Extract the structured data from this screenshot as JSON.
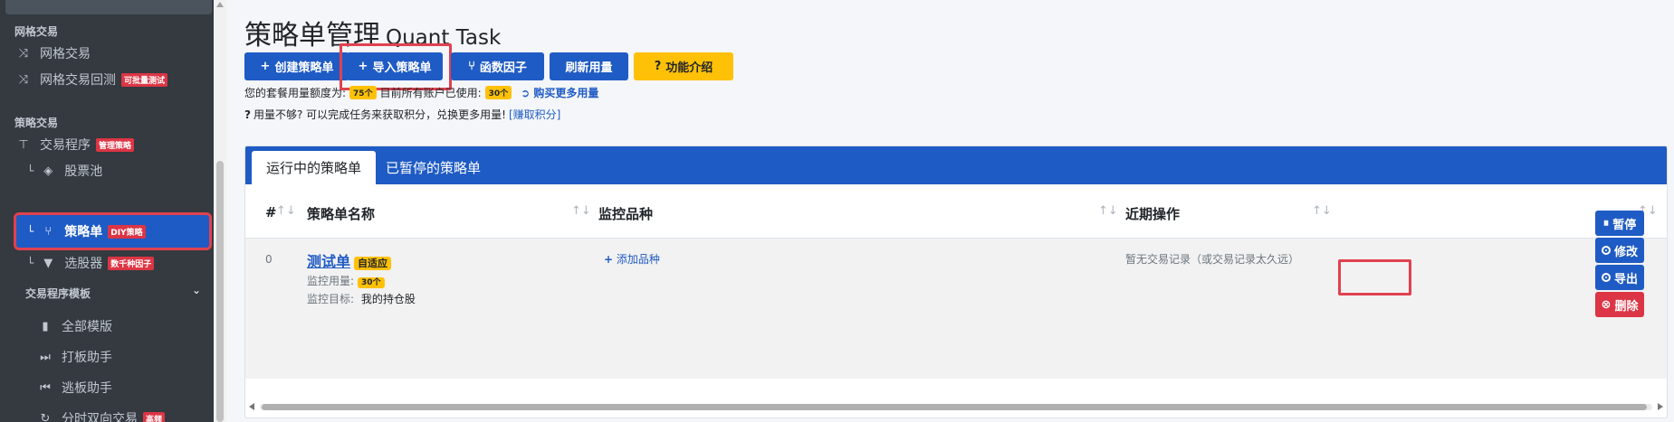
{
  "sidebar": {
    "sections": [
      {
        "header": "网格交易",
        "items": [
          {
            "label": "网格交易",
            "icon": "shuffle-icon"
          },
          {
            "label": "网格交易回测",
            "icon": "shuffle-icon",
            "badge": "可批量测试"
          }
        ]
      },
      {
        "header": "策略交易",
        "items": [
          {
            "label": "交易程序",
            "icon": "sitemap-icon",
            "badge": "管理策略"
          },
          {
            "label": "股票池",
            "icon": "cube-icon",
            "tree": "└"
          },
          {
            "label": "策略单",
            "icon": "diagram-icon",
            "tree": "└",
            "badge": "DIY策略",
            "active": true
          },
          {
            "label": "选股器",
            "icon": "filter-icon",
            "tree": "└",
            "badge": "数千种因子"
          }
        ]
      },
      {
        "header": "交易程序模板",
        "items": [
          {
            "label": "全部模版",
            "icon": "book-icon"
          },
          {
            "label": "打板助手",
            "icon": "fast-forward-icon"
          },
          {
            "label": "逃板助手",
            "icon": "fast-backward-icon"
          },
          {
            "label": "分时双向交易",
            "icon": "sync-icon",
            "badge": "高频"
          }
        ]
      }
    ]
  },
  "header": {
    "title": "策略单管理",
    "subtitle": "Quant Task"
  },
  "toolbar": {
    "create": "创建策略单",
    "import": "导入策略单",
    "factor": "函数因子",
    "refresh": "刷新用量",
    "intro": "功能介绍"
  },
  "quota": {
    "line1_prefix": "您的套餐用量额度为:",
    "quota_value": "75个",
    "line1_mid": "目前所有账户已使用:",
    "used_value": "30个",
    "buy_more": "购买更多用量",
    "line2": "用量不够? 可以完成任务来获取积分，兑换更多用量!",
    "earn_points": "[赚取积分]"
  },
  "tabs": {
    "running": "运行中的策略单",
    "paused": "已暂停的策略单"
  },
  "table": {
    "columns": [
      "#",
      "策略单名称",
      "监控品种",
      "近期操作"
    ],
    "row": {
      "index": "0",
      "name": "测试单",
      "name_badge": "自适应",
      "usage_label": "监控用量:",
      "usage_value": "30个",
      "target_label": "监控目标:",
      "target_value": "我的持仓股",
      "add_symbol": "添加品种",
      "recent_ops": "暂无交易记录（或交易记录太久远）",
      "actions": {
        "pause": "暂停",
        "edit": "修改",
        "export": "导出",
        "delete": "删除"
      }
    }
  },
  "colors": {
    "primary": "#1f5bc4",
    "danger": "#dc3545",
    "warning": "#ffc107",
    "highlight": "#e0414f",
    "sidebar_bg": "#343a40"
  }
}
